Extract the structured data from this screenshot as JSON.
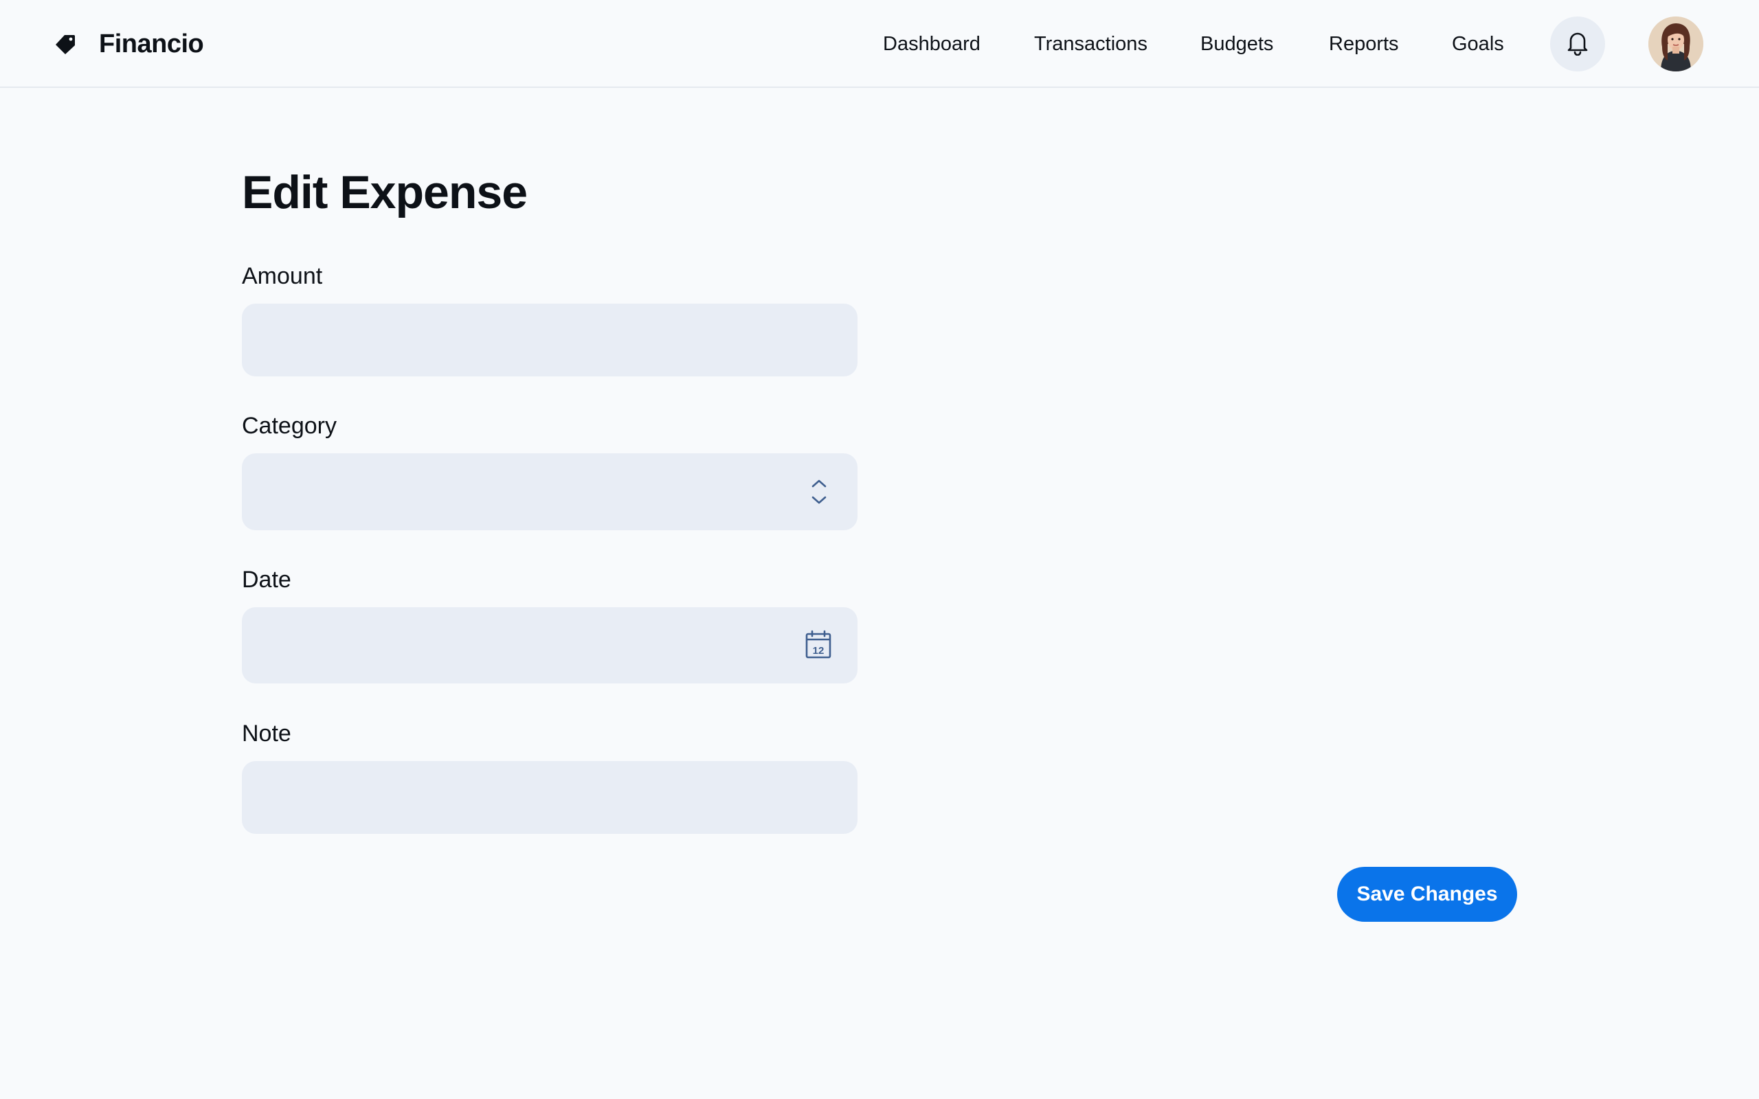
{
  "app": {
    "name": "Financio",
    "logo_icon": "tag-icon"
  },
  "nav": {
    "items": [
      {
        "label": "Dashboard"
      },
      {
        "label": "Transactions"
      },
      {
        "label": "Budgets"
      },
      {
        "label": "Reports"
      },
      {
        "label": "Goals"
      }
    ],
    "notification_icon": "bell-icon",
    "avatar_icon": "user-avatar"
  },
  "page": {
    "title": "Edit Expense"
  },
  "form": {
    "amount": {
      "label": "Amount",
      "value": "",
      "placeholder": ""
    },
    "category": {
      "label": "Category",
      "value": "",
      "icon": "chevron-up-down-icon"
    },
    "date": {
      "label": "Date",
      "value": "",
      "icon": "calendar-icon",
      "icon_text": "12"
    },
    "note": {
      "label": "Note",
      "value": "",
      "placeholder": ""
    },
    "save_label": "Save Changes"
  },
  "colors": {
    "accent": "#0a74ea",
    "field_bg": "#e8edf5",
    "page_bg": "#f8fafc",
    "icon": "#3f5f8f"
  }
}
